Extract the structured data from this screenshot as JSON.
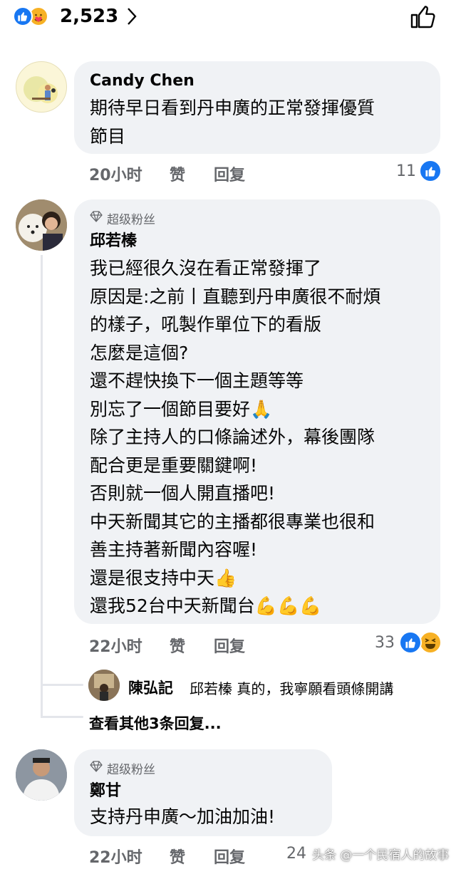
{
  "top": {
    "reaction_count": "2,523"
  },
  "comments": [
    {
      "name": "Candy Chen",
      "lines": [
        "期待早日看到丹申廣的正常發揮優質",
        "節目"
      ],
      "time": "20小时",
      "like": "赞",
      "reply": "回复",
      "reactions": "11"
    },
    {
      "badge": "超级粉丝",
      "name": "邱若榛",
      "lines": [
        "我已經很久沒在看正常發揮了",
        "原因是:之前丨直聽到丹申廣很不耐煩",
        "的樣子，吼製作單位下的看版",
        "怎麼是這個?",
        "還不趕快換下一個主題等等",
        "別忘了一個節目要好🙏",
        "除了主持人的口條論述外，幕後團隊",
        "配合更是重要關鍵啊!",
        "否則就一個人開直播吧!",
        "中天新聞其它的主播都很專業也很和",
        "善主持著新聞內容喔!",
        "還是很支持中天👍",
        "還我52台中天新聞台💪💪💪"
      ],
      "time": "22小时",
      "like": "赞",
      "reply": "回复",
      "reactions": "33",
      "reply_preview": {
        "name": "陳弘記",
        "text": "邱若榛 真的，我寧願看頭條開講"
      },
      "more_replies": "查看其他3条回复..."
    },
    {
      "badge": "超级粉丝",
      "name": "鄭甘",
      "lines": [
        "支持丹申廣～加油加油!"
      ],
      "time": "22小时",
      "like": "赞",
      "reply": "回复",
      "reactions": "24"
    }
  ],
  "watermark": "头条 @一个民宿人的故事"
}
